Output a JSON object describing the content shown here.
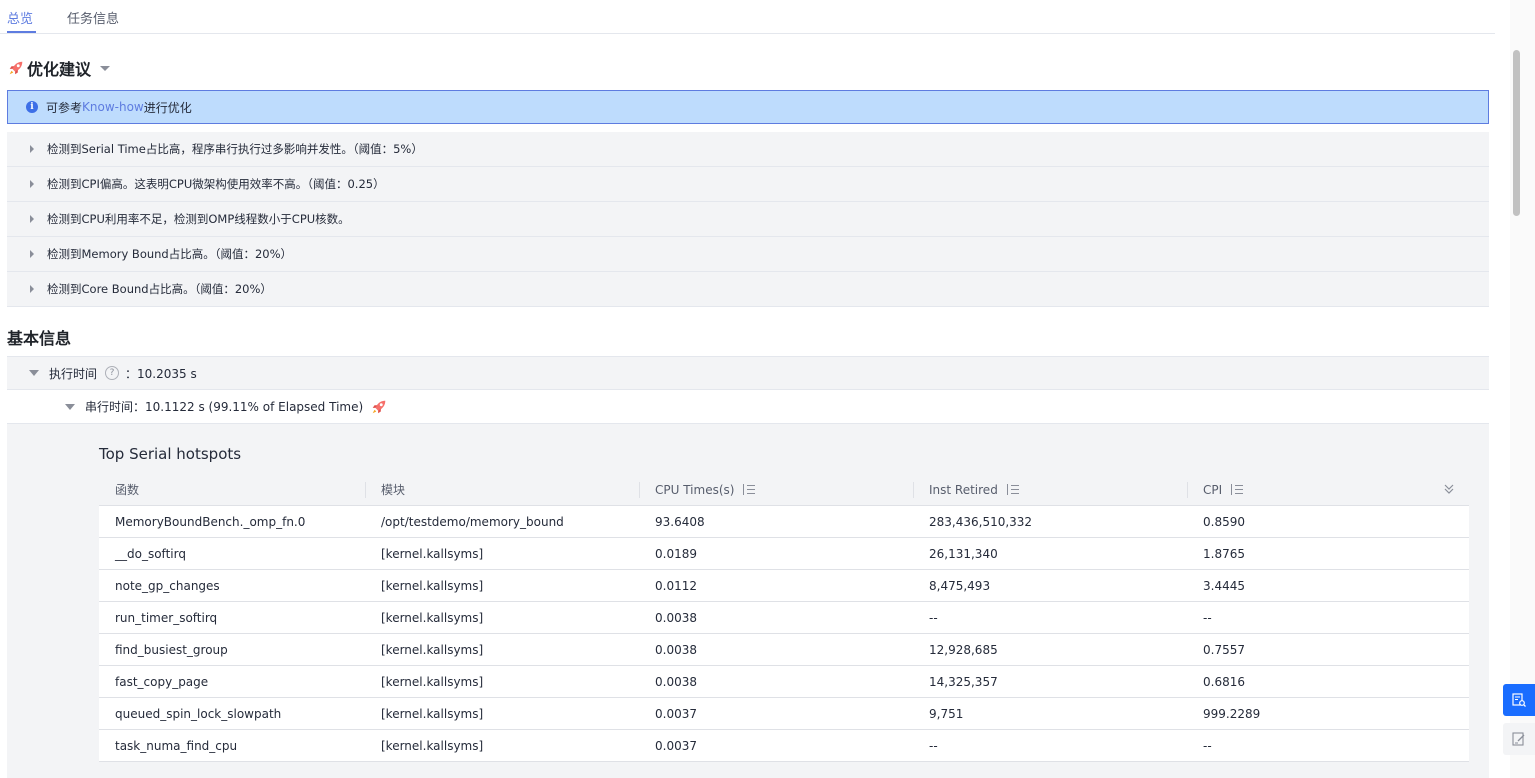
{
  "tabs": [
    {
      "label": "总览",
      "active": true
    },
    {
      "label": "任务信息",
      "active": false
    }
  ],
  "optimization": {
    "title": "优化建议",
    "banner": {
      "prefix": "可参考",
      "link": "Know-how",
      "suffix": "进行优化"
    },
    "items": [
      "检测到Serial Time占比高，程序串行执行过多影响并发性。（阈值：5%）",
      "检测到CPI偏高。这表明CPU微架构使用效率不高。（阈值：0.25）",
      "检测到CPU利用率不足，检测到OMP线程数小于CPU核数。",
      "检测到Memory Bound占比高。（阈值：20%）",
      "检测到Core Bound占比高。（阈值：20%）"
    ]
  },
  "basic_info": {
    "title": "基本信息",
    "exec_label": "执行时间",
    "exec_value": "：10.2035 s",
    "serial_label": "串行时间：",
    "serial_value": "10.1122 s (99.11% of Elapsed Time)"
  },
  "hotspots": {
    "title": "Top Serial hotspots",
    "columns": [
      "函数",
      "模块",
      "CPU Times(s)",
      "Inst Retired",
      "CPI"
    ],
    "rows": [
      [
        "MemoryBoundBench._omp_fn.0",
        "/opt/testdemo/memory_bound",
        "93.6408",
        "283,436,510,332",
        "0.8590"
      ],
      [
        "__do_softirq",
        "[kernel.kallsyms]",
        "0.0189",
        "26,131,340",
        "1.8765"
      ],
      [
        "note_gp_changes",
        "[kernel.kallsyms]",
        "0.0112",
        "8,475,493",
        "3.4445"
      ],
      [
        "run_timer_softirq",
        "[kernel.kallsyms]",
        "0.0038",
        "--",
        "--"
      ],
      [
        "find_busiest_group",
        "[kernel.kallsyms]",
        "0.0038",
        "12,928,685",
        "0.7557"
      ],
      [
        "fast_copy_page",
        "[kernel.kallsyms]",
        "0.0038",
        "14,325,357",
        "0.6816"
      ],
      [
        "queued_spin_lock_slowpath",
        "[kernel.kallsyms]",
        "0.0037",
        "9,751",
        "999.2289"
      ],
      [
        "task_numa_find_cpu",
        "[kernel.kallsyms]",
        "0.0037",
        "--",
        "--"
      ]
    ]
  },
  "icons": {
    "rocket": "rocket-icon",
    "info": "info-icon",
    "help": "help-icon",
    "sort": "sort-icon",
    "expand": "chevrons-down-icon",
    "analyze": "search-document-icon",
    "edit": "edit-document-icon"
  },
  "colors": {
    "accent": "#5e7ce0",
    "banner_bg": "#bedcfd",
    "float_primary": "#1a6dff",
    "rocket_red": "#f66f6a"
  }
}
